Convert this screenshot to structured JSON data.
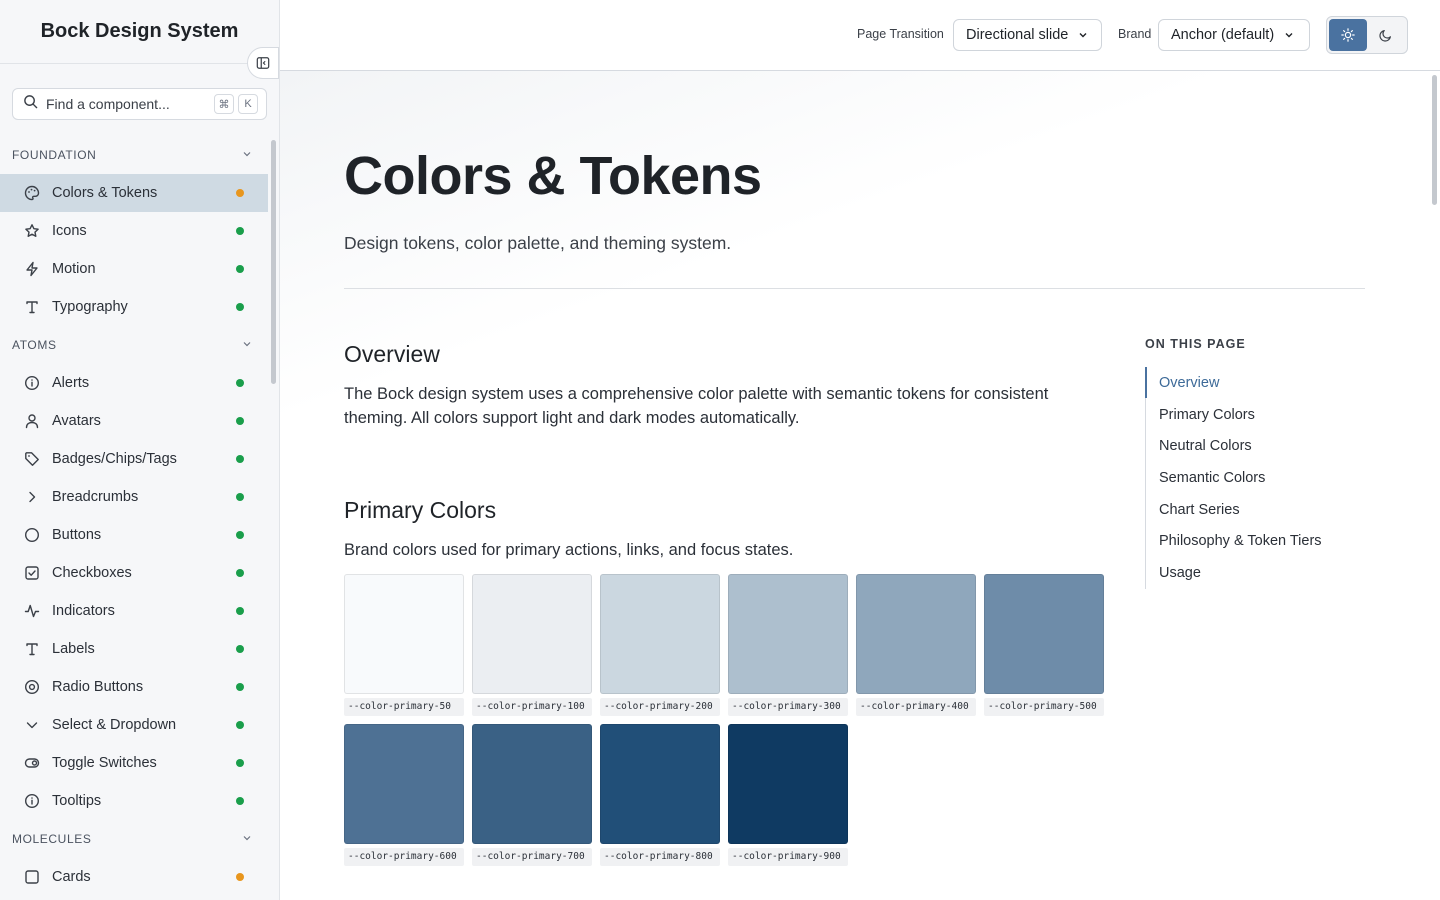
{
  "app": {
    "title": "Bock Design System"
  },
  "search": {
    "placeholder": "Find a component...",
    "kbd_mod": "⌘",
    "kbd_key": "K"
  },
  "sidebar": {
    "sections": [
      {
        "title": "FOUNDATION",
        "items": [
          {
            "label": "Colors & Tokens",
            "icon": "palette-icon",
            "status": "orange",
            "active": true
          },
          {
            "label": "Icons",
            "icon": "star-icon",
            "status": "green"
          },
          {
            "label": "Motion",
            "icon": "lightning-icon",
            "status": "green"
          },
          {
            "label": "Typography",
            "icon": "type-icon",
            "status": "green"
          }
        ]
      },
      {
        "title": "ATOMS",
        "items": [
          {
            "label": "Alerts",
            "icon": "info-circle-icon",
            "status": "green"
          },
          {
            "label": "Avatars",
            "icon": "user-icon",
            "status": "green"
          },
          {
            "label": "Badges/Chips/Tags",
            "icon": "tag-icon",
            "status": "green"
          },
          {
            "label": "Breadcrumbs",
            "icon": "chevron-right-icon",
            "status": "green"
          },
          {
            "label": "Buttons",
            "icon": "circle-icon",
            "status": "green"
          },
          {
            "label": "Checkboxes",
            "icon": "checkbox-icon",
            "status": "green"
          },
          {
            "label": "Indicators",
            "icon": "activity-icon",
            "status": "green"
          },
          {
            "label": "Labels",
            "icon": "type-icon",
            "status": "green"
          },
          {
            "label": "Radio Buttons",
            "icon": "radio-icon",
            "status": "green"
          },
          {
            "label": "Select & Dropdown",
            "icon": "chevron-down-icon",
            "status": "green"
          },
          {
            "label": "Toggle Switches",
            "icon": "toggle-icon",
            "status": "green"
          },
          {
            "label": "Tooltips",
            "icon": "info-circle-icon",
            "status": "green"
          }
        ]
      },
      {
        "title": "MOLECULES",
        "items": [
          {
            "label": "Cards",
            "icon": "square-icon",
            "status": "orange"
          }
        ]
      }
    ]
  },
  "topbar": {
    "transition_label": "Page Transition",
    "transition_value": "Directional slide",
    "brand_label": "Brand",
    "brand_value": "Anchor (default)",
    "theme": "light"
  },
  "main": {
    "title": "Colors & Tokens",
    "subtitle": "Design tokens, color palette, and theming system.",
    "overview_heading": "Overview",
    "overview_text": "The Bock design system uses a comprehensive color palette with semantic tokens for consistent theming. All colors support light and dark modes automatically.",
    "primary_heading": "Primary Colors",
    "primary_text": "Brand colors used for primary actions, links, and focus states.",
    "swatches": [
      {
        "name": "--color-primary-50",
        "color": "#f8fafc"
      },
      {
        "name": "--color-primary-100",
        "color": "#ebeef2"
      },
      {
        "name": "--color-primary-200",
        "color": "#cbd7e0"
      },
      {
        "name": "--color-primary-300",
        "color": "#adbfce"
      },
      {
        "name": "--color-primary-400",
        "color": "#8fa7bc"
      },
      {
        "name": "--color-primary-500",
        "color": "#6e8ca9"
      },
      {
        "name": "--color-primary-600",
        "color": "#4e7194"
      },
      {
        "name": "--color-primary-700",
        "color": "#3a6185"
      },
      {
        "name": "--color-primary-800",
        "color": "#214f78"
      },
      {
        "name": "--color-primary-900",
        "color": "#0f3a62"
      }
    ]
  },
  "toc": {
    "title": "ON THIS PAGE",
    "items": [
      "Overview",
      "Primary Colors",
      "Neutral Colors",
      "Semantic Colors",
      "Chart Series",
      "Philosophy & Token Tiers",
      "Usage"
    ],
    "active": 0
  },
  "colors": {
    "accent": "#4a72a0",
    "status_green": "#1a9e4b",
    "status_orange": "#e8961e",
    "active_bg": "#cfdae3"
  }
}
